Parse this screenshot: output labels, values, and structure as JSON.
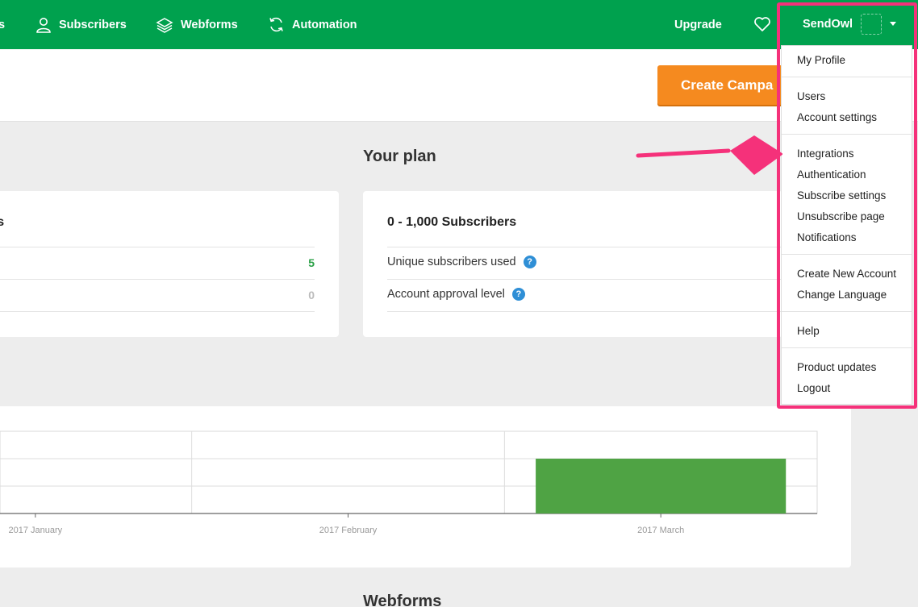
{
  "nav": {
    "items": [
      {
        "label": "s"
      },
      {
        "label": "Subscribers"
      },
      {
        "label": "Webforms"
      },
      {
        "label": "Automation"
      }
    ],
    "upgrade": "Upgrade",
    "account_name": "SendOwl"
  },
  "header": {
    "create_button": "Create Campa"
  },
  "plan": {
    "title": "Your plan",
    "left_card": {
      "title_fragment": "rs",
      "values": [
        "5",
        "0"
      ],
      "value_colors": [
        "#2aa046",
        "#bbbbbb"
      ]
    },
    "right_card": {
      "title": "0 - 1,000 Subscribers",
      "rows": [
        {
          "label": "Unique subscribers used",
          "help": "?"
        },
        {
          "label": "Account approval level",
          "help": "?"
        }
      ]
    }
  },
  "chart_data": {
    "type": "bar",
    "categories": [
      "2017 January",
      "2017 February",
      "2017 March"
    ],
    "values": [
      0,
      0,
      2
    ],
    "ylim": [
      0,
      3
    ],
    "grid": true,
    "colors": {
      "bar": "#4fa344"
    }
  },
  "webforms_title": "Webforms",
  "dropdown": {
    "groups": [
      [
        "My Profile"
      ],
      [
        "Users",
        "Account settings"
      ],
      [
        "Integrations",
        "Authentication",
        "Subscribe settings",
        "Unsubscribe page",
        "Notifications"
      ],
      [
        "Create New Account",
        "Change Language"
      ],
      [
        "Help"
      ],
      [
        "Product updates",
        "Logout"
      ]
    ]
  },
  "colors": {
    "brand_green": "#00a14e",
    "cta_orange": "#f58a1f",
    "annotation_pink": "#f5317a",
    "help_blue": "#2f8fd6"
  }
}
